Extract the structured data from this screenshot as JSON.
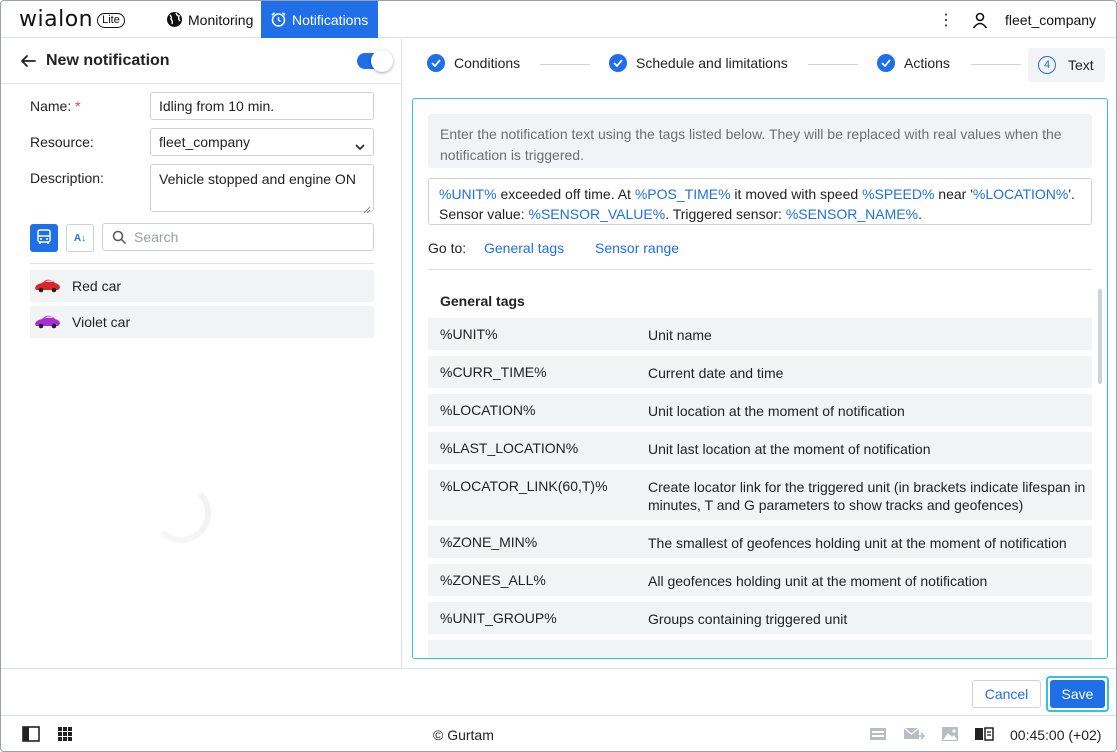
{
  "app": {
    "logo_text": "wialon",
    "logo_badge": "Lite",
    "user_name": "fleet_company"
  },
  "nav": {
    "monitoring": "Monitoring",
    "notifications": "Notifications"
  },
  "icons": {
    "globe": "globe-icon",
    "alarm": "alarm-clock-icon",
    "more": "kebab-icon",
    "user": "user-icon"
  },
  "colors": {
    "accent": "#1e6fe8",
    "focus_ring": "#35c3dc"
  },
  "left": {
    "title": "New notification",
    "enabled": true,
    "name_label": "Name:",
    "required_mark": "*",
    "name_value": "Idling from 10 min.",
    "resource_label": "Resource:",
    "resource_value": "fleet_company",
    "description_label": "Description:",
    "description_value": "Vehicle stopped and engine ON",
    "sort_label": "A↓",
    "search_placeholder": "Search",
    "units": [
      {
        "name": "Red car",
        "color": "#d8262a"
      },
      {
        "name": "Violet car",
        "color": "#a72dd6"
      }
    ]
  },
  "steps": [
    {
      "label": "Conditions",
      "done": true
    },
    {
      "label": "Schedule and limitations",
      "done": true
    },
    {
      "label": "Actions",
      "done": true
    },
    {
      "label": "Text",
      "number": "4",
      "active": true
    }
  ],
  "content": {
    "hint": "Enter the notification text using the tags listed below. They will be replaced with real values when the notification is triggered.",
    "message": {
      "line1": [
        {
          "t": "%UNIT%",
          "tag": true
        },
        {
          "t": " exceeded off time. At ",
          "tag": false
        },
        {
          "t": "%POS_TIME%",
          "tag": true
        },
        {
          "t": " it moved with speed ",
          "tag": false
        },
        {
          "t": "%SPEED%",
          "tag": true
        },
        {
          "t": " near '",
          "tag": false
        },
        {
          "t": "%LOCATION%",
          "tag": true
        },
        {
          "t": "'.",
          "tag": false
        }
      ],
      "line2": [
        {
          "t": "Sensor value: ",
          "tag": false
        },
        {
          "t": "%SENSOR_VALUE%",
          "tag": true
        },
        {
          "t": ". Triggered sensor: ",
          "tag": false
        },
        {
          "t": "%SENSOR_NAME%",
          "tag": true
        },
        {
          "t": ".",
          "tag": false
        }
      ]
    },
    "goto_label": "Go to:",
    "goto_links": [
      "General tags",
      "Sensor range"
    ],
    "section_title": "General tags",
    "tags": [
      {
        "tag": "%UNIT%",
        "desc": "Unit name"
      },
      {
        "tag": "%CURR_TIME%",
        "desc": "Current date and time"
      },
      {
        "tag": "%LOCATION%",
        "desc": "Unit location at the moment of notification"
      },
      {
        "tag": "%LAST_LOCATION%",
        "desc": "Unit last location at the moment of notification"
      },
      {
        "tag": "%LOCATOR_LINK(60,T)%",
        "desc": "Create locator link for the triggered unit (in brackets indicate lifespan in minutes, T and G parameters to show tracks and geofences)"
      },
      {
        "tag": "%ZONE_MIN%",
        "desc": "The smallest of geofences holding unit at the moment of notification"
      },
      {
        "tag": "%ZONES_ALL%",
        "desc": "All geofences holding unit at the moment of notification"
      },
      {
        "tag": "%UNIT_GROUP%",
        "desc": "Groups containing triggered unit"
      }
    ]
  },
  "buttons": {
    "cancel": "Cancel",
    "save": "Save"
  },
  "statusbar": {
    "copyright": "© Gurtam",
    "time": "00:45:00 (+02)"
  }
}
